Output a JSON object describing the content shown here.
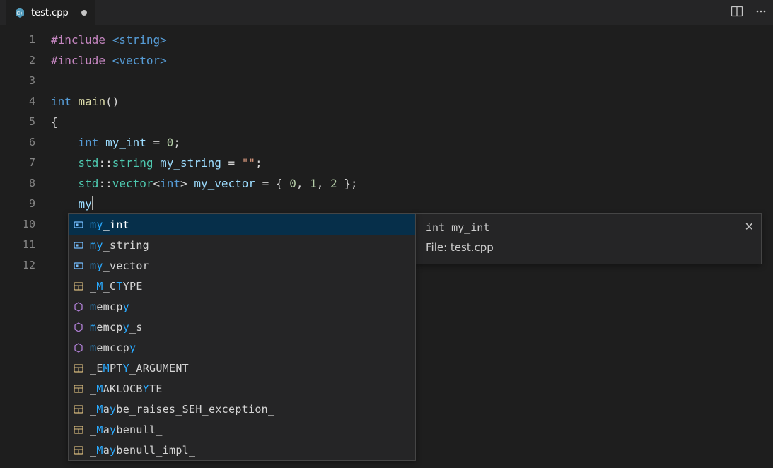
{
  "tab": {
    "filename": "test.cpp",
    "dirty": true
  },
  "gutter": {
    "start": 1,
    "end": 12
  },
  "code": {
    "include_kw": "#include",
    "inc1": "<string>",
    "inc2": "<vector>",
    "int_kw": "int",
    "main_fn": "main",
    "parens": "()",
    "lbrace": "{",
    "rbrace": "",
    "var_my_int": "my_int",
    "eq": " = ",
    "zero": "0",
    "semi": ";",
    "std": "std",
    "dcolon": "::",
    "string_t": "string",
    "my_string": "my_string",
    "empty_str": "\"\"",
    "vector_t": "vector",
    "lt": "<",
    "gt": ">",
    "my_vector": "my_vector",
    "list_open": " = { ",
    "n0": "0",
    "c": ", ",
    "n1": "1",
    "n2": "2",
    "list_close": " };",
    "typed": "my"
  },
  "suggest": {
    "selectedIndex": 0,
    "items": [
      {
        "icon": "variable",
        "plain": "my_int",
        "hl": [
          0,
          1
        ]
      },
      {
        "icon": "variable",
        "plain": "my_string",
        "hl": [
          0,
          1
        ]
      },
      {
        "icon": "variable",
        "plain": "my_vector",
        "hl": [
          0,
          1
        ]
      },
      {
        "icon": "const",
        "plain": "_M_CTYPE",
        "hl": [
          1,
          4
        ]
      },
      {
        "icon": "method",
        "plain": "memcpy",
        "hl": [
          0,
          5
        ]
      },
      {
        "icon": "method",
        "plain": "memcpy_s",
        "hl": [
          0,
          5
        ]
      },
      {
        "icon": "method",
        "plain": "memccpy",
        "hl": [
          0,
          6
        ]
      },
      {
        "icon": "const",
        "plain": "_EMPTY_ARGUMENT",
        "hl": [
          2,
          5
        ]
      },
      {
        "icon": "const",
        "plain": "_MAKLOCBYTE",
        "hl": [
          1,
          8
        ]
      },
      {
        "icon": "const",
        "plain": "_Maybe_raises_SEH_exception_",
        "hl": [
          1,
          3
        ]
      },
      {
        "icon": "const",
        "plain": "_Maybenull_",
        "hl": [
          1,
          3
        ]
      },
      {
        "icon": "const",
        "plain": "_Maybenull_impl_",
        "hl": [
          1,
          3
        ]
      }
    ],
    "detail": {
      "signature": "int my_int",
      "file_label": "File: ",
      "file_value": "test.cpp"
    }
  }
}
